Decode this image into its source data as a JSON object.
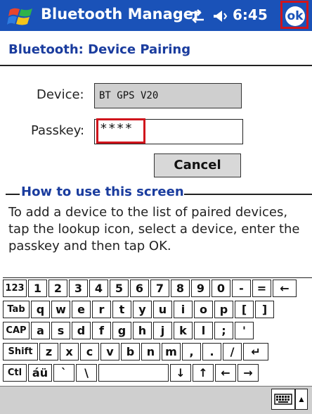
{
  "titlebar": {
    "app_title": "Bluetooth Manager",
    "clock": "6:45",
    "ok_label": "ok",
    "icons": [
      "windows-flag-icon",
      "connectivity-icon",
      "volume-icon"
    ]
  },
  "page": {
    "title": "Bluetooth: Device Pairing",
    "device_label": "Device:",
    "device_value": "BT GPS V20",
    "passkey_label": "Passkey:",
    "passkey_value": "****",
    "cancel_label": "Cancel",
    "section_title": "How to use this screen",
    "help_text": "To add a device to the list of paired devices, tap the lookup icon, select a device, enter the passkey and then tap OK."
  },
  "keyboard": {
    "rows": [
      [
        "123",
        "1",
        "2",
        "3",
        "4",
        "5",
        "6",
        "7",
        "8",
        "9",
        "0",
        "-",
        "=",
        "←"
      ],
      [
        "Tab",
        "q",
        "w",
        "e",
        "r",
        "t",
        "y",
        "u",
        "i",
        "o",
        "p",
        "[",
        "]"
      ],
      [
        "CAP",
        "a",
        "s",
        "d",
        "f",
        "g",
        "h",
        "j",
        "k",
        "l",
        ";",
        "'"
      ],
      [
        "Shift",
        "z",
        "x",
        "c",
        "v",
        "b",
        "n",
        "m",
        ",",
        ".",
        "/",
        "↵"
      ],
      [
        "Ctl",
        "áü",
        "`",
        "\\",
        "",
        "↓",
        "↑",
        "←",
        "→"
      ]
    ]
  },
  "colors": {
    "titlebar": "#1a52b8",
    "accent_text": "#1a3c9e",
    "highlight": "#d0141c"
  }
}
